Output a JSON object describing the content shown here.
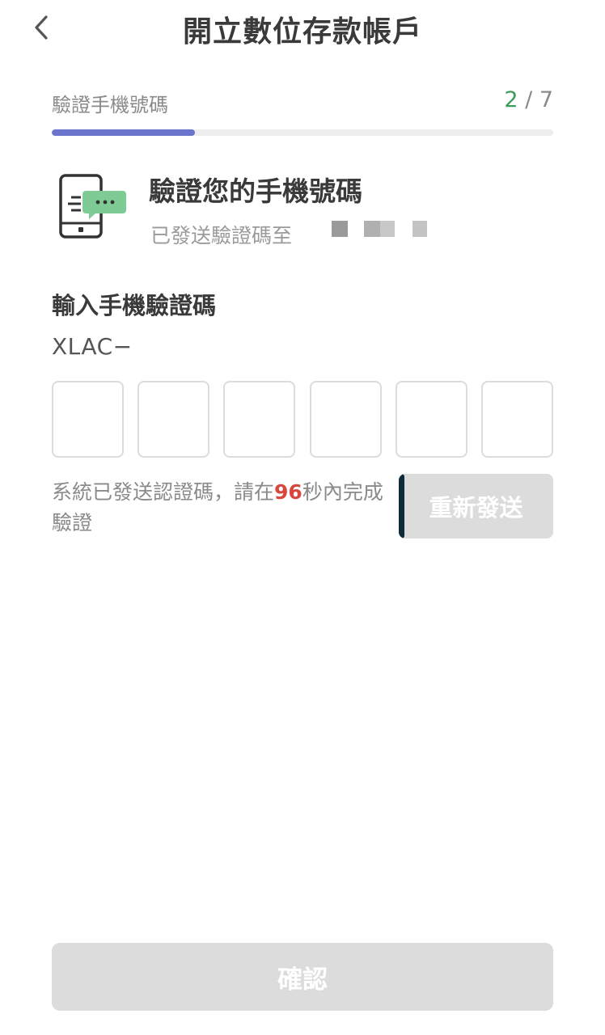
{
  "header": {
    "title": "開立數位存款帳戶",
    "back_icon": "chevron-left-icon"
  },
  "progress": {
    "step_label": "驗證手機號碼",
    "current_step": "2",
    "separator": " / ",
    "total_steps": "7",
    "fraction": 0.285,
    "fill_color": "#6b75cc",
    "current_color": "#3d9c5a"
  },
  "info": {
    "icon": "phone-message-icon",
    "title": "驗證您的手機號碼",
    "subtitle": "已發送驗證碼至"
  },
  "code_input": {
    "label": "輸入手機驗證碼",
    "prefix": "XLAC−",
    "digits": [
      "",
      "",
      "",
      "",
      "",
      ""
    ]
  },
  "countdown": {
    "text_before": "系統已發送認證碼，請在",
    "seconds": "96",
    "text_after": "秒內完成驗證",
    "seconds_color": "#d9463e"
  },
  "buttons": {
    "resend_label": "重新發送",
    "confirm_label": "確認"
  }
}
